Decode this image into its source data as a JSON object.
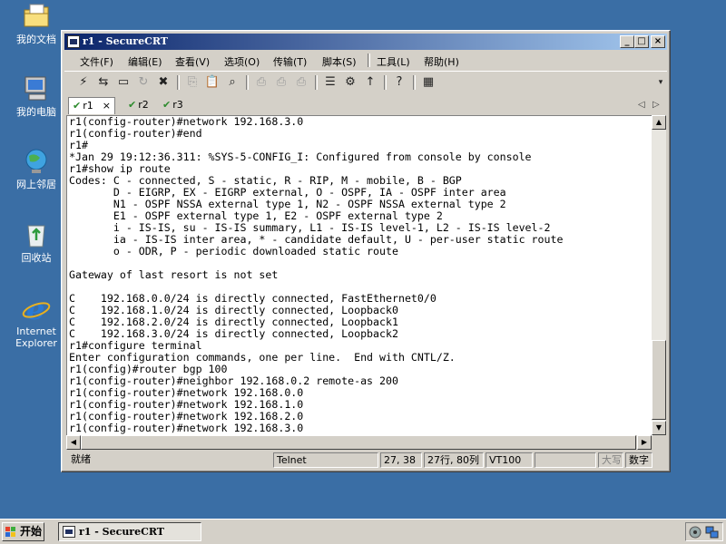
{
  "desktop": {
    "icons": [
      {
        "label": "我的文档",
        "icon": "my-documents-icon"
      },
      {
        "label": "我的电脑",
        "icon": "my-computer-icon"
      },
      {
        "label": "网上邻居",
        "icon": "network-places-icon"
      },
      {
        "label": "回收站",
        "icon": "recycle-bin-icon"
      },
      {
        "label": "Internet Explorer",
        "icon": "internet-explorer-icon"
      }
    ]
  },
  "window": {
    "title": "r1 - SecureCRT",
    "controls": {
      "minimize": "_",
      "maximize": "□",
      "close": "×"
    },
    "menu": [
      "文件(F)",
      "编辑(E)",
      "查看(V)",
      "选项(O)",
      "传输(T)",
      "脚本(S)",
      "工具(L)",
      "帮助(H)"
    ],
    "tabs": [
      {
        "label": "r1",
        "active": true,
        "close": "×"
      },
      {
        "label": "r2",
        "active": false
      },
      {
        "label": "r3",
        "active": false
      }
    ],
    "tab_nav": {
      "prev": "◁",
      "next": "▷"
    },
    "terminal_lines": [
      "r1(config-router)#network 192.168.3.0",
      "r1(config-router)#end",
      "r1#",
      "*Jan 29 19:12:36.311: %SYS-5-CONFIG_I: Configured from console by console",
      "r1#show ip route",
      "Codes: C - connected, S - static, R - RIP, M - mobile, B - BGP",
      "       D - EIGRP, EX - EIGRP external, O - OSPF, IA - OSPF inter area",
      "       N1 - OSPF NSSA external type 1, N2 - OSPF NSSA external type 2",
      "       E1 - OSPF external type 1, E2 - OSPF external type 2",
      "       i - IS-IS, su - IS-IS summary, L1 - IS-IS level-1, L2 - IS-IS level-2",
      "       ia - IS-IS inter area, * - candidate default, U - per-user static route",
      "       o - ODR, P - periodic downloaded static route",
      "",
      "Gateway of last resort is not set",
      "",
      "C    192.168.0.0/24 is directly connected, FastEthernet0/0",
      "C    192.168.1.0/24 is directly connected, Loopback0",
      "C    192.168.2.0/24 is directly connected, Loopback1",
      "C    192.168.3.0/24 is directly connected, Loopback2",
      "r1#configure terminal",
      "Enter configuration commands, one per line.  End with CNTL/Z.",
      "r1(config)#router bgp 100",
      "r1(config-router)#neighbor 192.168.0.2 remote-as 200",
      "r1(config-router)#network 192.168.0.0",
      "r1(config-router)#network 192.168.1.0",
      "r1(config-router)#network 192.168.2.0",
      "r1(config-router)#network 192.168.3.0"
    ],
    "status": {
      "ready": "就绪",
      "protocol": "Telnet",
      "cursor": "27, 38",
      "size": "27行, 80列",
      "emulation": "VT100",
      "caps": "大写",
      "num": "数字"
    }
  },
  "taskbar": {
    "start_label": "开始",
    "task_title": "r1 - SecureCRT"
  }
}
